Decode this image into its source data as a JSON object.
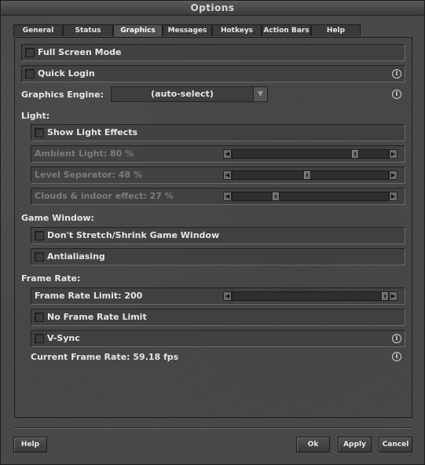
{
  "window": {
    "title": "Options"
  },
  "tabs": [
    {
      "label": "General"
    },
    {
      "label": "Status"
    },
    {
      "label": "Graphics"
    },
    {
      "label": "Messages"
    },
    {
      "label": "Hotkeys"
    },
    {
      "label": "Action Bars"
    },
    {
      "label": "Help"
    }
  ],
  "active_tab": "Graphics",
  "options": {
    "full_screen_mode": {
      "label": "Full Screen Mode",
      "checked": false
    },
    "quick_login": {
      "label": "Quick Login",
      "checked": false
    },
    "graphics_engine": {
      "label": "Graphics Engine:",
      "value": "(auto-select)"
    },
    "light_heading": "Light:",
    "show_light_effects": {
      "label": "Show Light Effects",
      "checked": false
    },
    "ambient_light": {
      "label": "Ambient Light: 80 %",
      "value_percent": 80
    },
    "level_separator": {
      "label": "Level Separator: 48 %",
      "value_percent": 48
    },
    "clouds_indoor": {
      "label": "Clouds & indoor effect: 27 %",
      "value_percent": 27
    },
    "game_window_heading": "Game Window:",
    "dont_stretch": {
      "label": "Don't Stretch/Shrink Game Window",
      "checked": false
    },
    "antialiasing": {
      "label": "Antialiasing",
      "checked": false
    },
    "frame_rate_heading": "Frame Rate:",
    "frame_rate_limit": {
      "label": "Frame Rate Limit: 200",
      "value_fraction": 1.0
    },
    "no_frame_rate_limit": {
      "label": "No Frame Rate Limit",
      "checked": false
    },
    "vsync": {
      "label": "V-Sync",
      "checked": false
    },
    "current_frame_rate": "Current Frame Rate: 59.18 fps"
  },
  "icons": {
    "info": "i",
    "left_arrow": "◀",
    "right_arrow": "▶",
    "dropdown_arrow": "▼"
  },
  "buttons": {
    "help": "Help",
    "ok": "Ok",
    "apply": "Apply",
    "cancel": "Cancel"
  }
}
